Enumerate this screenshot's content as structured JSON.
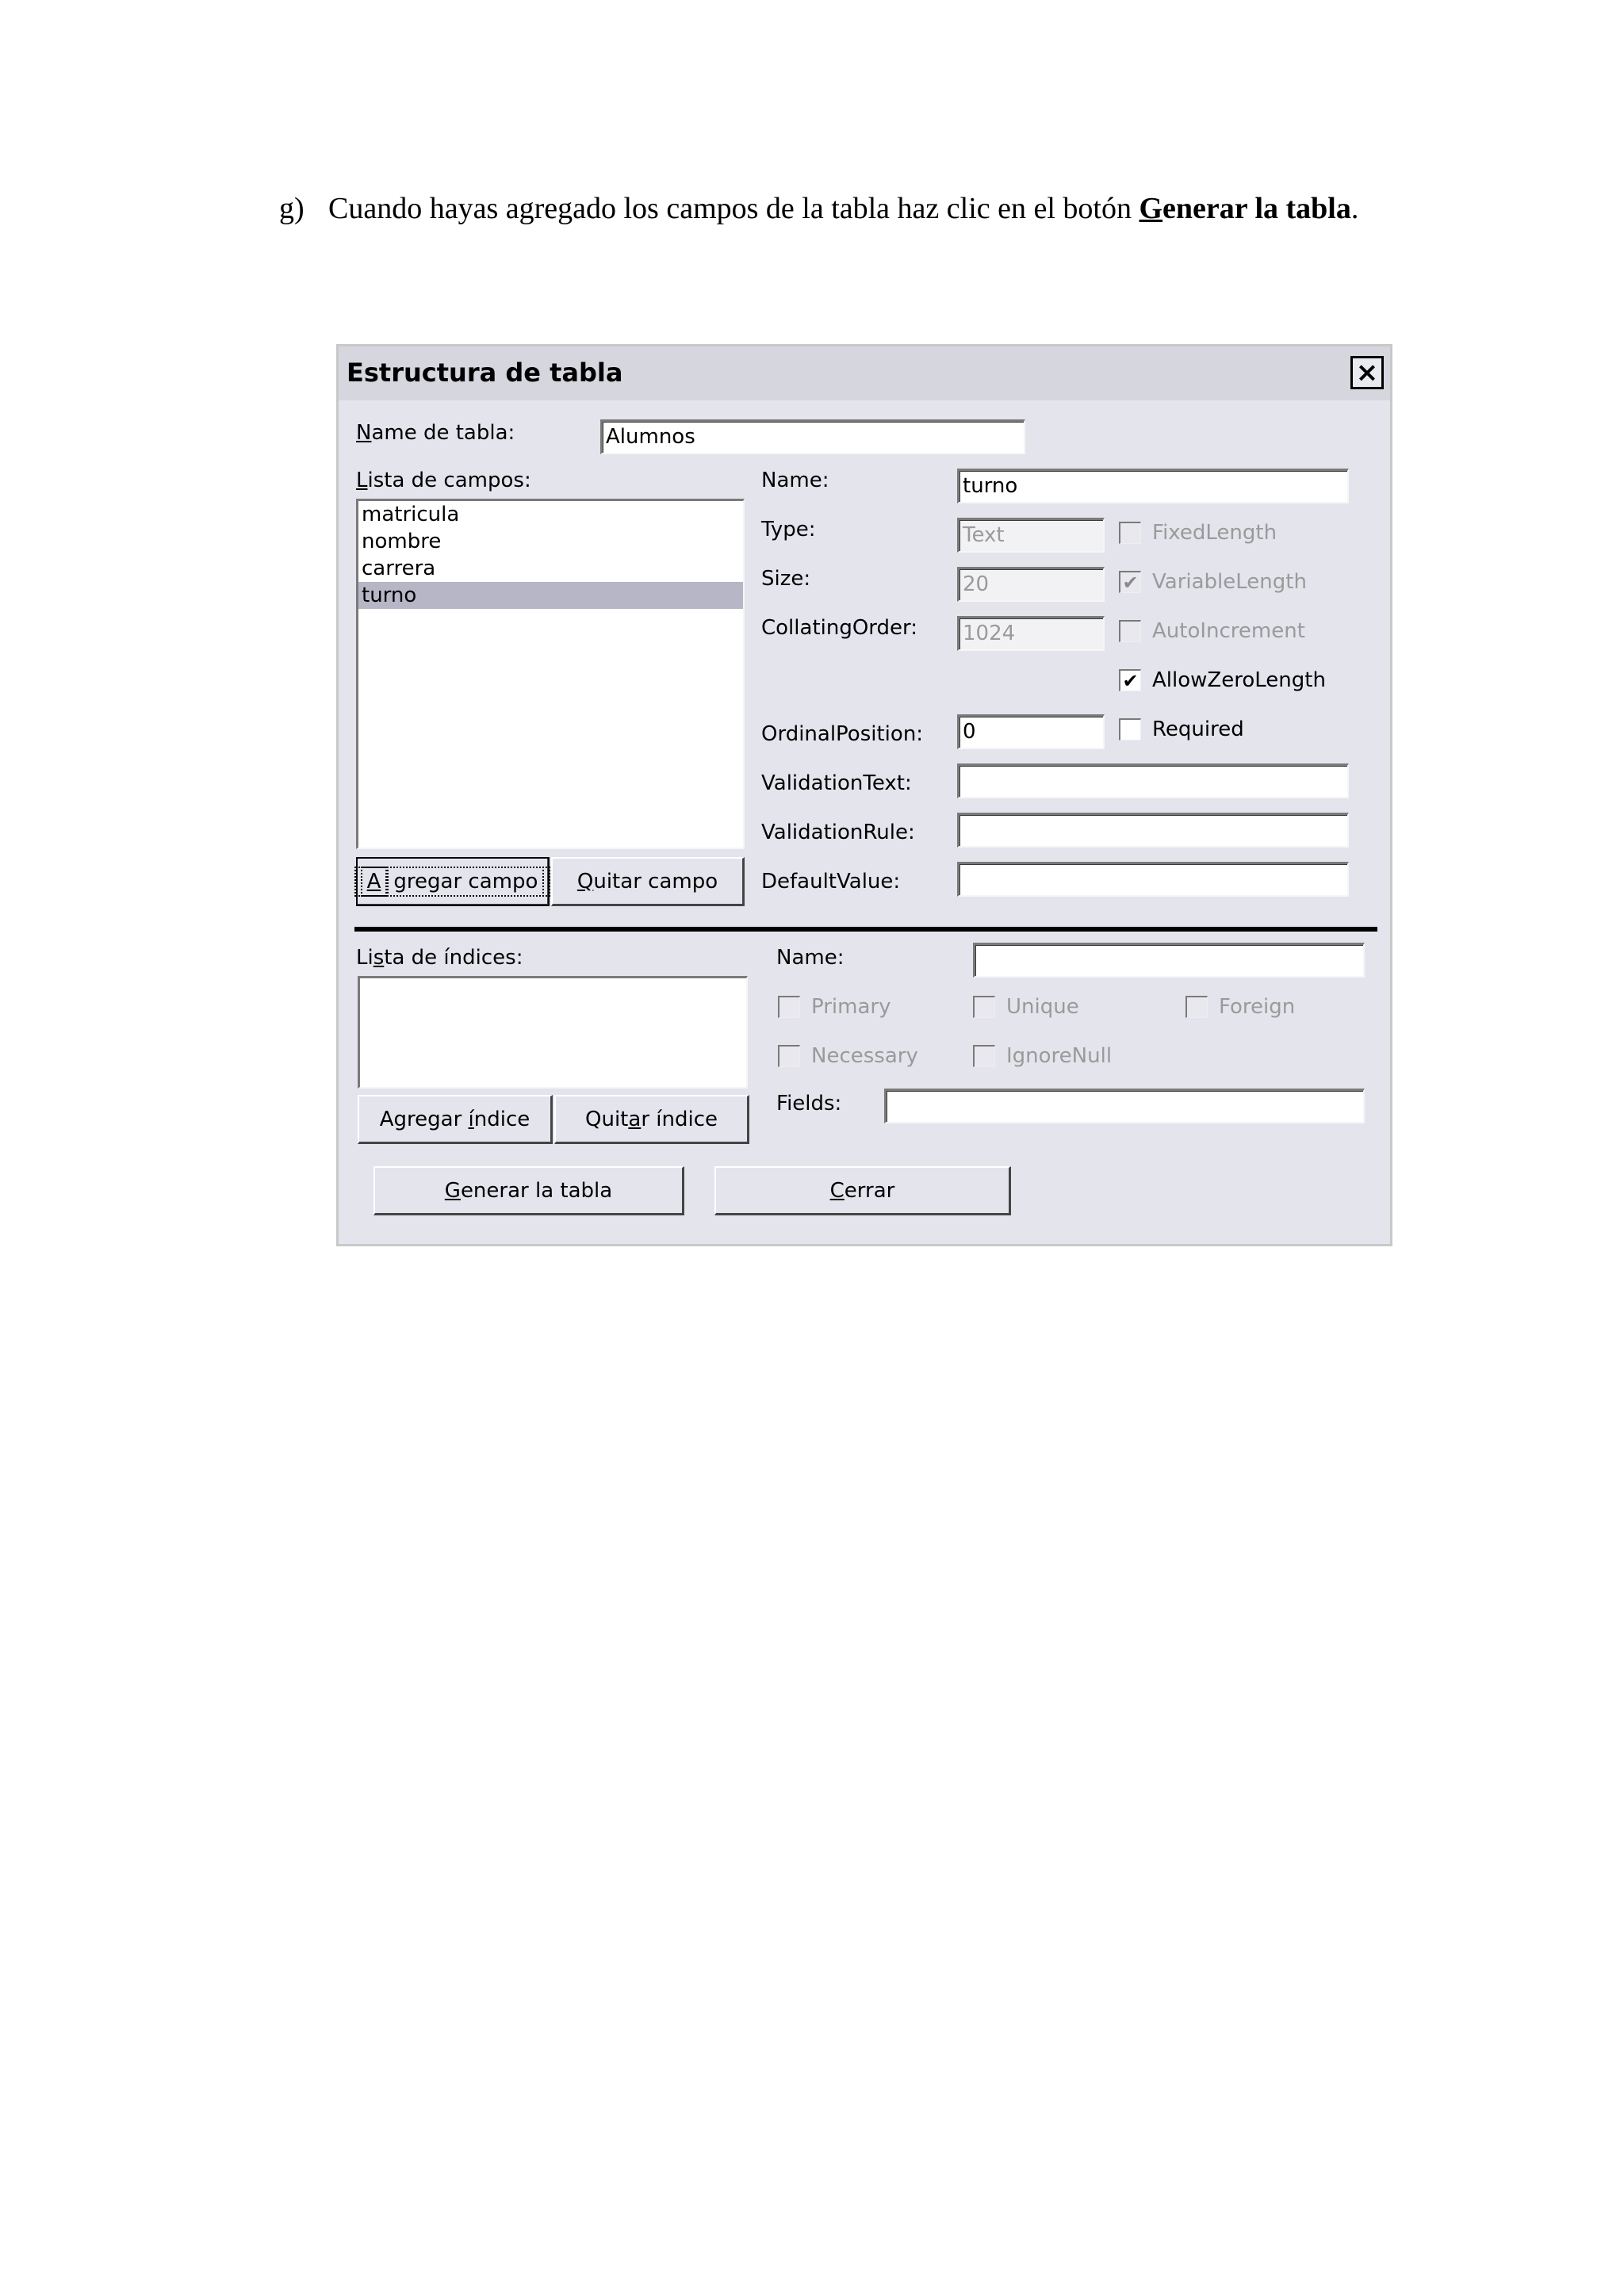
{
  "instruction": {
    "marker": "g)",
    "text_before": "Cuando hayas agregado los campos de la tabla haz clic en el botón ",
    "bold_first_letter": "G",
    "bold_rest": "enerar la tabla",
    "text_after": "."
  },
  "dialog": {
    "title": "Estructura de tabla",
    "close_symbol": "×",
    "table_name": {
      "label_key": "N",
      "label_rest": "ame de tabla:",
      "value": "Alumnos"
    },
    "fields_list": {
      "label_key": "L",
      "label_rest": "ista de campos:",
      "items": [
        "matricula",
        "nombre",
        "carrera",
        "turno"
      ],
      "selected_index": 3
    },
    "add_field_button": {
      "key": "A",
      "rest": "gregar campo"
    },
    "remove_field_button": {
      "key": "Q",
      "rest": "uitar campo"
    },
    "field_props": {
      "name_label": "Name:",
      "name_value": "turno",
      "type_label": "Type:",
      "type_value": "Text",
      "size_label": "Size:",
      "size_value": "20",
      "collating_label": "CollatingOrder:",
      "collating_value": "1024",
      "ordinal_label": "OrdinalPosition:",
      "ordinal_value": "0",
      "validation_text_label": "ValidationText:",
      "validation_text_value": "",
      "validation_rule_label": "ValidationRule:",
      "validation_rule_value": "",
      "default_value_label": "DefaultValue:",
      "default_value_value": ""
    },
    "field_checks": {
      "fixed_length": {
        "label": "FixedLength",
        "checked": false,
        "enabled": false
      },
      "variable_length": {
        "label": "VariableLength",
        "checked": true,
        "enabled": false
      },
      "auto_increment": {
        "label": "AutoIncrement",
        "checked": false,
        "enabled": false
      },
      "allow_zero_length": {
        "label": "AllowZeroLength",
        "checked": true,
        "enabled": true
      },
      "required": {
        "label": "Required",
        "checked": false,
        "enabled": true
      }
    },
    "index_list": {
      "label_a": "Li",
      "label_key": "s",
      "label_rest": "ta de índices:",
      "items": []
    },
    "add_index_button": {
      "pre": "Agregar ",
      "key": "í",
      "rest": "ndice"
    },
    "remove_index_button": {
      "pre": "Quit",
      "key": "a",
      "rest": "r índice"
    },
    "index_props": {
      "name_label": "Name:",
      "name_value": "",
      "fields_label": "Fields:",
      "fields_value": ""
    },
    "index_checks": {
      "primary": {
        "label": "Primary",
        "checked": false,
        "enabled": false
      },
      "unique": {
        "label": "Unique",
        "checked": false,
        "enabled": false
      },
      "foreign": {
        "label": "Foreign",
        "checked": false,
        "enabled": false
      },
      "necessary": {
        "label": "Necessary",
        "checked": false,
        "enabled": false
      },
      "ignore_null": {
        "label": "IgnoreNull",
        "checked": false,
        "enabled": false
      }
    },
    "generate_button": {
      "key": "G",
      "rest": "enerar la tabla"
    },
    "close_button": {
      "key": "C",
      "rest": "errar"
    },
    "check_mark": "✔"
  }
}
